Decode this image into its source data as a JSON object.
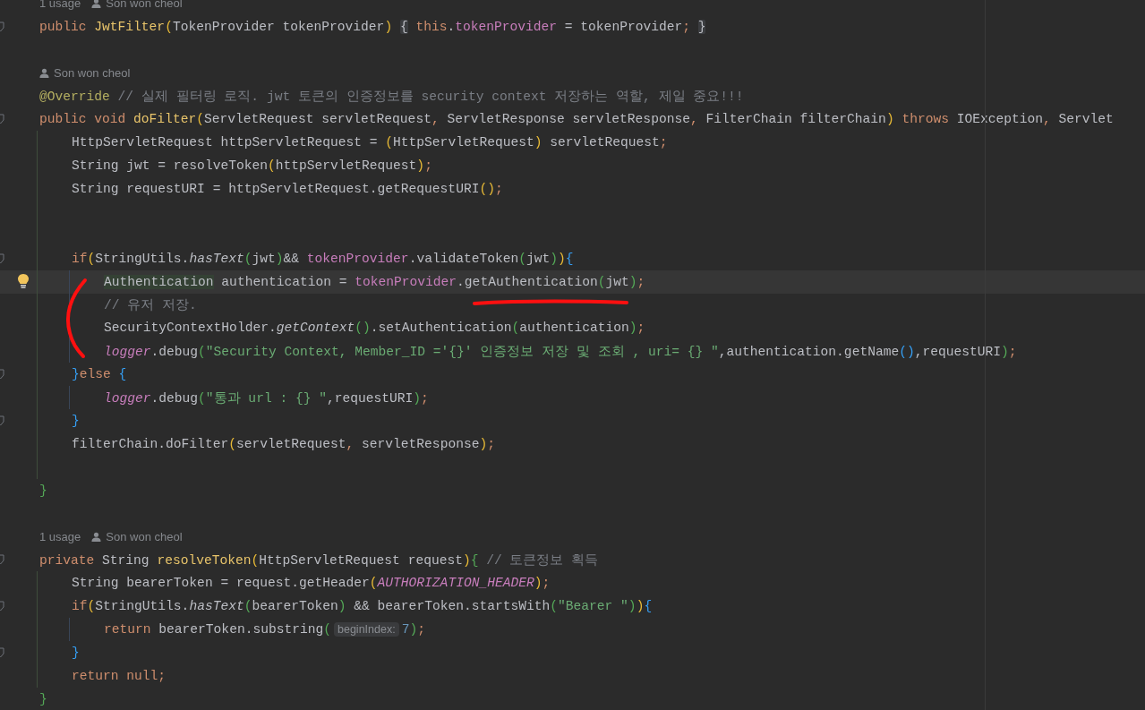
{
  "intention_bulb": true,
  "lines": [
    {
      "kind": "hint",
      "usages": "1 usage",
      "author": "Son won cheol"
    },
    {
      "kind": "code",
      "fold": true,
      "current": false,
      "tokens": [
        {
          "text": "public ",
          "kind": "kw"
        },
        {
          "text": "JwtFilter",
          "kind": "fn"
        },
        {
          "text": "(",
          "kind": "py"
        },
        {
          "text": "TokenProvider tokenProvider",
          "kind": "pl"
        },
        {
          "text": ") ",
          "kind": "py"
        },
        {
          "text": "{",
          "kind": "mt"
        },
        {
          "text": " this",
          "kind": "kw"
        },
        {
          "text": ".",
          "kind": "pl"
        },
        {
          "text": "tokenProvider",
          "kind": "fd"
        },
        {
          "text": " = tokenProvider",
          "kind": "pl"
        },
        {
          "text": "; ",
          "kind": "pu"
        },
        {
          "text": "}",
          "kind": "mt"
        }
      ]
    },
    {
      "kind": "blank"
    },
    {
      "kind": "hint",
      "author": "Son won cheol"
    },
    {
      "kind": "code",
      "fold": false,
      "current": false,
      "tokens": [
        {
          "text": "@Override",
          "kind": "an"
        },
        {
          "text": " // 실제 필터링 로직. jwt 토큰의 인증정보를 security context 저장하는 역할, 제일 중요!!!",
          "kind": "cm"
        }
      ]
    },
    {
      "kind": "code",
      "fold": true,
      "current": false,
      "tokens": [
        {
          "text": "public void ",
          "kind": "kw"
        },
        {
          "text": "doFilter",
          "kind": "fn"
        },
        {
          "text": "(",
          "kind": "py"
        },
        {
          "text": "ServletRequest servletRequest",
          "kind": "pl"
        },
        {
          "text": ",",
          "kind": "pu"
        },
        {
          "text": " ServletResponse servletResponse",
          "kind": "pl"
        },
        {
          "text": ",",
          "kind": "pu"
        },
        {
          "text": " FilterChain filterChain",
          "kind": "pl"
        },
        {
          "text": ")",
          "kind": "py"
        },
        {
          "text": " throws",
          "kind": "kw"
        },
        {
          "text": " IOException",
          "kind": "pl"
        },
        {
          "text": ",",
          "kind": "pu"
        },
        {
          "text": " Servlet",
          "kind": "pl"
        }
      ],
      "children": [
        {
          "kind": "code",
          "fold": false,
          "current": false,
          "tokens": [
            {
              "text": "HttpServletRequest httpServletRequest = ",
              "kind": "pl"
            },
            {
              "text": "(",
              "kind": "py"
            },
            {
              "text": "HttpServletRequest",
              "kind": "pl"
            },
            {
              "text": ")",
              "kind": "py"
            },
            {
              "text": " servletRequest",
              "kind": "pl"
            },
            {
              "text": ";",
              "kind": "pu"
            }
          ]
        },
        {
          "kind": "code",
          "fold": false,
          "current": false,
          "tokens": [
            {
              "text": "String jwt = resolveToken",
              "kind": "pl"
            },
            {
              "text": "(",
              "kind": "py"
            },
            {
              "text": "httpServletRequest",
              "kind": "pl"
            },
            {
              "text": ")",
              "kind": "py"
            },
            {
              "text": ";",
              "kind": "pu"
            }
          ]
        },
        {
          "kind": "code",
          "fold": false,
          "current": false,
          "tokens": [
            {
              "text": "String requestURI = httpServletRequest.getRequestURI",
              "kind": "pl"
            },
            {
              "text": "()",
              "kind": "py"
            },
            {
              "text": ";",
              "kind": "pu"
            }
          ]
        },
        {
          "kind": "blank"
        },
        {
          "kind": "blank"
        },
        {
          "kind": "code",
          "fold": true,
          "current": false,
          "tokens": [
            {
              "text": "if",
              "kind": "kw"
            },
            {
              "text": "(",
              "kind": "py"
            },
            {
              "text": "StringUtils.",
              "kind": "pl"
            },
            {
              "text": "hasText",
              "kind": "it"
            },
            {
              "text": "(",
              "kind": "pg"
            },
            {
              "text": "jwt",
              "kind": "pl"
            },
            {
              "text": ")",
              "kind": "pg"
            },
            {
              "text": "&& ",
              "kind": "pl"
            },
            {
              "text": "tokenProvider",
              "kind": "fd"
            },
            {
              "text": ".validateToken",
              "kind": "pl"
            },
            {
              "text": "(",
              "kind": "pg"
            },
            {
              "text": "jwt",
              "kind": "pl"
            },
            {
              "text": ")",
              "kind": "pg"
            },
            {
              "text": ")",
              "kind": "py"
            },
            {
              "text": "{",
              "kind": "pb"
            }
          ],
          "children": [
            {
              "kind": "code",
              "fold": false,
              "current": true,
              "tokens": [
                {
                  "text": "Authentication",
                  "kind": "mk"
                },
                {
                  "text": " authentication = ",
                  "kind": "pl"
                },
                {
                  "text": "tokenProvider",
                  "kind": "fd"
                },
                {
                  "text": ".getAuthentication",
                  "kind": "pl"
                },
                {
                  "text": "(",
                  "kind": "pg"
                },
                {
                  "text": "jwt",
                  "kind": "pl"
                },
                {
                  "text": ")",
                  "kind": "pg"
                },
                {
                  "text": ";",
                  "kind": "pu"
                }
              ]
            },
            {
              "kind": "code",
              "fold": false,
              "current": false,
              "tokens": [
                {
                  "text": "// 유저 저장.",
                  "kind": "cm"
                }
              ]
            },
            {
              "kind": "code",
              "fold": false,
              "current": false,
              "tokens": [
                {
                  "text": "SecurityContextHolder.",
                  "kind": "pl"
                },
                {
                  "text": "getContext",
                  "kind": "it"
                },
                {
                  "text": "()",
                  "kind": "pg"
                },
                {
                  "text": ".setAuthentication",
                  "kind": "pl"
                },
                {
                  "text": "(",
                  "kind": "pg"
                },
                {
                  "text": "authentication",
                  "kind": "pl"
                },
                {
                  "text": ")",
                  "kind": "pg"
                },
                {
                  "text": ";",
                  "kind": "pu"
                }
              ]
            },
            {
              "kind": "code",
              "fold": false,
              "current": false,
              "tokens": [
                {
                  "text": "logger",
                  "kind": "fdi"
                },
                {
                  "text": ".debug",
                  "kind": "pl"
                },
                {
                  "text": "(",
                  "kind": "pg"
                },
                {
                  "text": "\"Security Context, Member_ID ='{}' 인증정보 저장 및 조회 , uri= {} \"",
                  "kind": "st"
                },
                {
                  "text": ",authentication.getName",
                  "kind": "pl"
                },
                {
                  "text": "()",
                  "kind": "pb"
                },
                {
                  "text": ",requestURI",
                  "kind": "pl"
                },
                {
                  "text": ")",
                  "kind": "pg"
                },
                {
                  "text": ";",
                  "kind": "pu"
                }
              ]
            }
          ]
        },
        {
          "kind": "code",
          "fold": true,
          "current": false,
          "tokens": [
            {
              "text": "}",
              "kind": "pb"
            },
            {
              "text": "else ",
              "kind": "kw"
            },
            {
              "text": "{",
              "kind": "pb"
            }
          ],
          "children": [
            {
              "kind": "code",
              "fold": false,
              "current": false,
              "tokens": [
                {
                  "text": "logger",
                  "kind": "fdi"
                },
                {
                  "text": ".debug",
                  "kind": "pl"
                },
                {
                  "text": "(",
                  "kind": "pg"
                },
                {
                  "text": "\"통과 url : {} \"",
                  "kind": "st"
                },
                {
                  "text": ",requestURI",
                  "kind": "pl"
                },
                {
                  "text": ")",
                  "kind": "pg"
                },
                {
                  "text": ";",
                  "kind": "pu"
                }
              ]
            }
          ]
        },
        {
          "kind": "code",
          "fold": true,
          "current": false,
          "tokens": [
            {
              "text": "}",
              "kind": "pb"
            }
          ]
        },
        {
          "kind": "code",
          "fold": false,
          "current": false,
          "tokens": [
            {
              "text": "filterChain.doFilter",
              "kind": "pl"
            },
            {
              "text": "(",
              "kind": "py"
            },
            {
              "text": "servletRequest",
              "kind": "pl"
            },
            {
              "text": ",",
              "kind": "pu"
            },
            {
              "text": " servletResponse",
              "kind": "pl"
            },
            {
              "text": ")",
              "kind": "py"
            },
            {
              "text": ";",
              "kind": "pu"
            }
          ]
        },
        {
          "kind": "blank"
        }
      ]
    },
    {
      "kind": "code",
      "fold": false,
      "current": false,
      "tokens": [
        {
          "text": "}",
          "kind": "pg"
        }
      ]
    },
    {
      "kind": "blank"
    },
    {
      "kind": "hint",
      "usages": "1 usage",
      "author": "Son won cheol"
    },
    {
      "kind": "code",
      "fold": true,
      "current": false,
      "tokens": [
        {
          "text": "private ",
          "kind": "kw"
        },
        {
          "text": "String ",
          "kind": "pl"
        },
        {
          "text": "resolveToken",
          "kind": "fn"
        },
        {
          "text": "(",
          "kind": "py"
        },
        {
          "text": "HttpServletRequest request",
          "kind": "pl"
        },
        {
          "text": ")",
          "kind": "py"
        },
        {
          "text": "{",
          "kind": "pg"
        },
        {
          "text": " // 토큰정보 획득",
          "kind": "cm"
        }
      ],
      "children": [
        {
          "kind": "code",
          "fold": false,
          "current": false,
          "tokens": [
            {
              "text": "String bearerToken = request.getHeader",
              "kind": "pl"
            },
            {
              "text": "(",
              "kind": "py"
            },
            {
              "text": "AUTHORIZATION_HEADER",
              "kind": "fdi"
            },
            {
              "text": ")",
              "kind": "py"
            },
            {
              "text": ";",
              "kind": "pu"
            }
          ]
        },
        {
          "kind": "code",
          "fold": true,
          "current": false,
          "tokens": [
            {
              "text": "if",
              "kind": "kw"
            },
            {
              "text": "(",
              "kind": "py"
            },
            {
              "text": "StringUtils.",
              "kind": "pl"
            },
            {
              "text": "hasText",
              "kind": "it"
            },
            {
              "text": "(",
              "kind": "pg"
            },
            {
              "text": "bearerToken",
              "kind": "pl"
            },
            {
              "text": ")",
              "kind": "pg"
            },
            {
              "text": " && bearerToken.startsWith",
              "kind": "pl"
            },
            {
              "text": "(",
              "kind": "pg"
            },
            {
              "text": "\"Bearer \"",
              "kind": "st"
            },
            {
              "text": ")",
              "kind": "pg"
            },
            {
              "text": ")",
              "kind": "py"
            },
            {
              "text": "{",
              "kind": "pb"
            }
          ],
          "children": [
            {
              "kind": "code",
              "fold": false,
              "current": false,
              "tokens": [
                {
                  "text": "return ",
                  "kind": "kw"
                },
                {
                  "text": "bearerToken.substring",
                  "kind": "pl"
                },
                {
                  "text": "(",
                  "kind": "pg"
                },
                {
                  "text": "beginIndex:",
                  "kind": "inlay"
                },
                {
                  "text": "7",
                  "kind": "nu"
                },
                {
                  "text": ")",
                  "kind": "pg"
                },
                {
                  "text": ";",
                  "kind": "pu"
                }
              ]
            }
          ]
        },
        {
          "kind": "code",
          "fold": true,
          "current": false,
          "tokens": [
            {
              "text": "}",
              "kind": "pb"
            }
          ]
        },
        {
          "kind": "code",
          "fold": false,
          "current": false,
          "tokens": [
            {
              "text": "return null",
              "kind": "kw"
            },
            {
              "text": ";",
              "kind": "pu"
            }
          ]
        }
      ]
    },
    {
      "kind": "code",
      "fold": false,
      "current": false,
      "tokens": [
        {
          "text": "}",
          "kind": "pg"
        }
      ]
    }
  ]
}
